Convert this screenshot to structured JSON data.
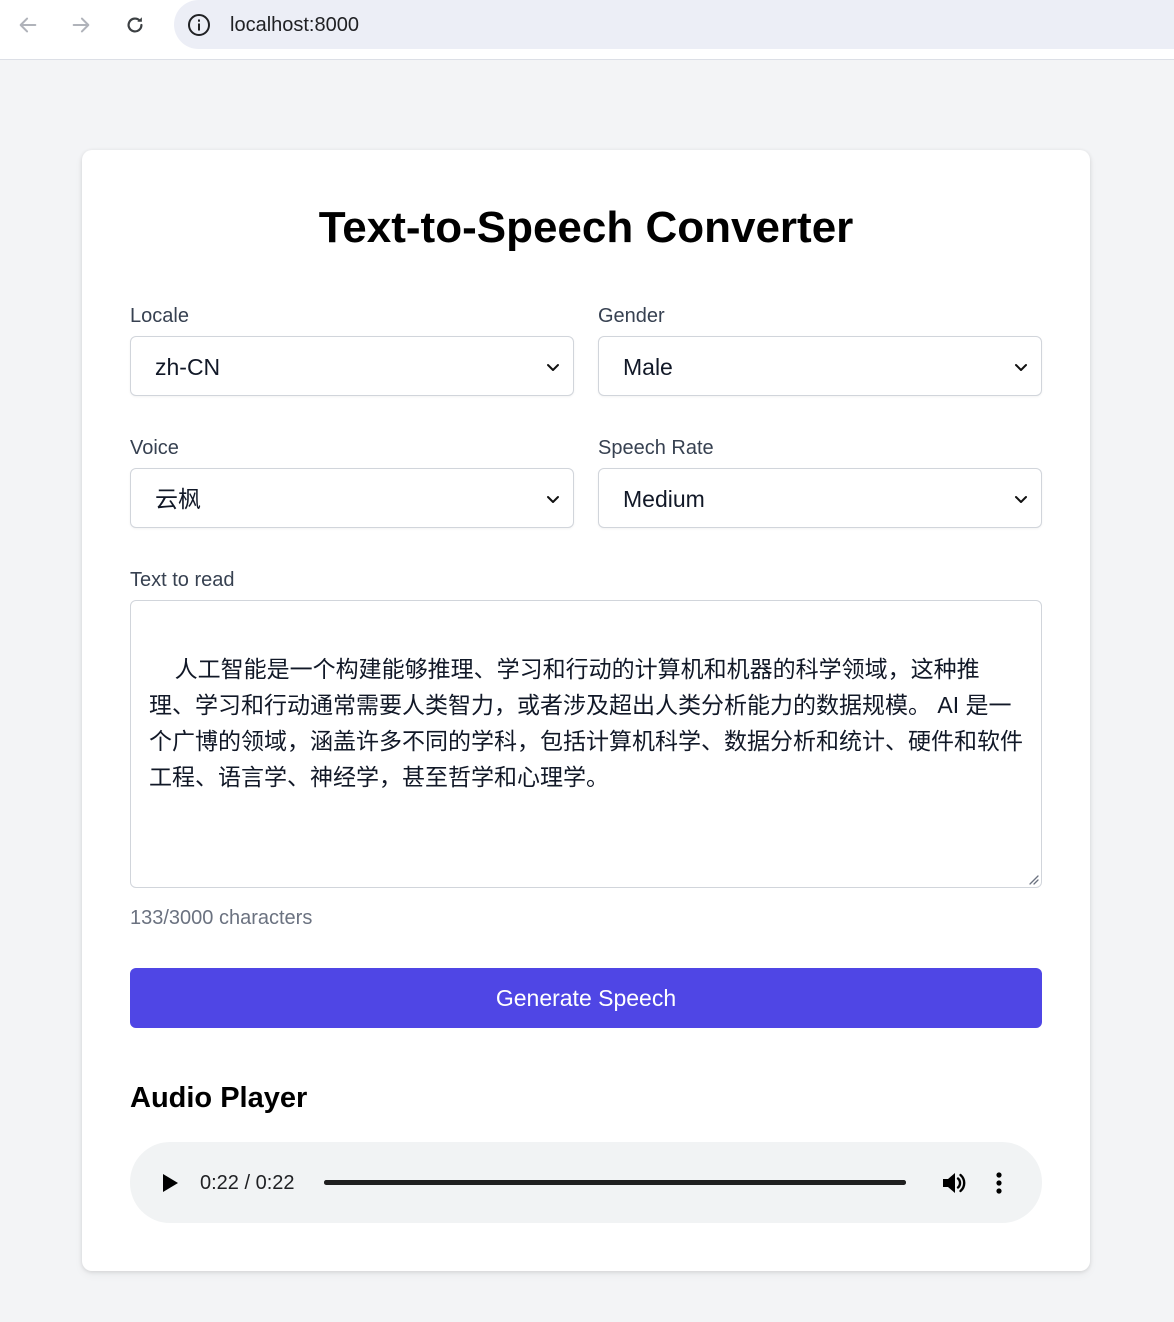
{
  "browser": {
    "url": "localhost:8000"
  },
  "page": {
    "title": "Text-to-Speech Converter"
  },
  "form": {
    "locale": {
      "label": "Locale",
      "value": "zh-CN"
    },
    "gender": {
      "label": "Gender",
      "value": "Male"
    },
    "voice": {
      "label": "Voice",
      "value": "云枫"
    },
    "speech_rate": {
      "label": "Speech Rate",
      "value": "Medium"
    },
    "text": {
      "label": "Text to read",
      "value": "人工智能是一个构建能够推理、学习和行动的计算机和机器的科学领域，这种推理、学习和行动通常需要人类智力，或者涉及超出人类分析能力的数据规模。 AI 是一个广博的领域，涵盖许多不同的学科，包括计算机科学、数据分析和统计、硬件和软件工程、语言学、神经学，甚至哲学和心理学。"
    },
    "char_count": "133/3000 characters",
    "generate_label": "Generate Speech"
  },
  "audio": {
    "title": "Audio Player",
    "time": "0:22 / 0:22",
    "progress": 1.0
  },
  "colors": {
    "primary": "#4f46e5",
    "page_bg": "#f3f4f6",
    "player_bg": "#f1f3f4"
  },
  "icons": {
    "back": "arrow-left-icon",
    "forward": "arrow-right-icon",
    "reload": "reload-icon",
    "info": "info-icon",
    "chevron": "chevron-down-icon",
    "play": "play-icon",
    "volume": "volume-icon",
    "more": "more-vertical-icon"
  }
}
